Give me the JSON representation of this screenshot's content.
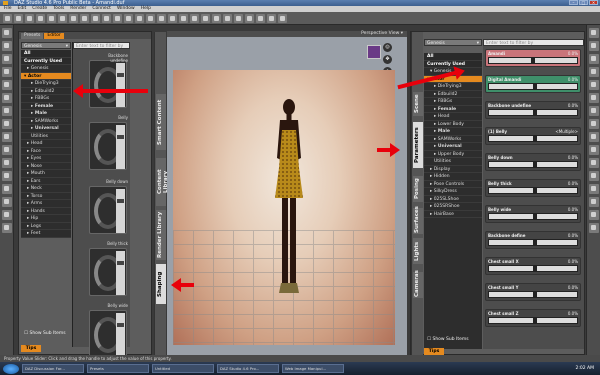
{
  "window": {
    "title": "DAZ Studio 4.6 Pro Public Beta - Amandi.duf"
  },
  "menu": [
    "File",
    "Edit",
    "Create",
    "Tools",
    "Render",
    "Connect",
    "Window",
    "Help"
  ],
  "left_panel": {
    "tabs": [
      {
        "label": "Presets"
      },
      {
        "label": "Editor"
      }
    ],
    "filter_dropdown": "Genesis",
    "search_placeholder": "Enter text to filter by",
    "tree": [
      {
        "label": "All",
        "style": "hdr"
      },
      {
        "label": "Currently Used",
        "style": "hdr"
      },
      {
        "label": "▸ Genesis",
        "style": "l1"
      },
      {
        "label": "▾ Actor",
        "style": "sel"
      },
      {
        "label": "▸ DieTrying3",
        "style": "l2"
      },
      {
        "label": "▸ Edbuild2",
        "style": "l2"
      },
      {
        "label": "▸ FBBGs",
        "style": "l2"
      },
      {
        "label": "▸ Female",
        "style": "l2 b"
      },
      {
        "label": "▸ Male",
        "style": "l2 b"
      },
      {
        "label": "▸ SAMWorks",
        "style": "l2"
      },
      {
        "label": "▸ Universal",
        "style": "l2 b"
      },
      {
        "label": "Utilities",
        "style": "l2"
      },
      {
        "label": "▸ Head",
        "style": "l1"
      },
      {
        "label": "▸ Face",
        "style": "l1"
      },
      {
        "label": "▸ Eyes",
        "style": "l1"
      },
      {
        "label": "▸ Nose",
        "style": "l1"
      },
      {
        "label": "▸ Mouth",
        "style": "l1"
      },
      {
        "label": "▸ Ears",
        "style": "l1"
      },
      {
        "label": "▸ Neck",
        "style": "l1"
      },
      {
        "label": "▸ Torso",
        "style": "l1"
      },
      {
        "label": "▸ Arms",
        "style": "l1"
      },
      {
        "label": "▸ Hands",
        "style": "l1"
      },
      {
        "label": "▸ Hip",
        "style": "l1"
      },
      {
        "label": "▸ Legs",
        "style": "l1"
      },
      {
        "label": "▸ Feet",
        "style": "l1"
      }
    ],
    "show_sub_items": "Show Sub Items",
    "tips": "Tips",
    "cards": [
      {
        "label": "Backbone undefine"
      },
      {
        "label": "Belly"
      },
      {
        "label": "Belly down"
      },
      {
        "label": "Belly thick"
      },
      {
        "label": "Belly wide"
      }
    ],
    "vtabs": [
      "Smart Content",
      "Content Library",
      "Render Library",
      "Shaping"
    ]
  },
  "viewport": {
    "camera_label": "Perspective View"
  },
  "right_panel": {
    "filter_dropdown": "Genesis",
    "search_placeholder": "Enter text to filter by",
    "tree": [
      {
        "label": "All",
        "style": "hdr"
      },
      {
        "label": "Currently Used",
        "style": "hdr"
      },
      {
        "label": "▾ Genesis",
        "style": "l1"
      },
      {
        "label": "▾ Actor",
        "style": "sel"
      },
      {
        "label": "▸ DieTrying3",
        "style": "l2"
      },
      {
        "label": "▸ Edbuild2",
        "style": "l2"
      },
      {
        "label": "▸ FBBGs",
        "style": "l2"
      },
      {
        "label": "▸ Female",
        "style": "l2 b"
      },
      {
        "label": "▸ Head",
        "style": "l2"
      },
      {
        "label": "▸ Lower Body",
        "style": "l2"
      },
      {
        "label": "▸ Male",
        "style": "l2 b"
      },
      {
        "label": "▸ SAMWorks",
        "style": "l2"
      },
      {
        "label": "▸ Universal",
        "style": "l2 b"
      },
      {
        "label": "▸ Upper Body",
        "style": "l2"
      },
      {
        "label": "Utilities",
        "style": "l2"
      },
      {
        "label": "▸ Display",
        "style": "l1"
      },
      {
        "label": "▸ Hidden",
        "style": "l1"
      },
      {
        "label": "▸ Pose Controls",
        "style": "l1"
      },
      {
        "label": "▸ SilkyDress",
        "style": "l1"
      },
      {
        "label": "▸ 025SLShoe",
        "style": "l1"
      },
      {
        "label": "▸ 025SRShoe",
        "style": "l1"
      },
      {
        "label": "▸ HairBase",
        "style": "l1"
      }
    ],
    "show_sub_items": "Show Sub Items",
    "tips": "Tips",
    "vtabs": [
      "Scene",
      "Parameters",
      "Posing",
      "Surfaces",
      "Lights",
      "Cameras"
    ],
    "sliders": [
      {
        "name": "Amandi",
        "value": "0.0%",
        "pos": 0.48,
        "color": "#c9747a"
      },
      {
        "name": "Digital Amandi",
        "value": "0.0%",
        "pos": 0.5,
        "color": "#3f8f6a"
      },
      {
        "name": "Backbone undefine",
        "value": "0.0%",
        "pos": 0.5,
        "color": "#444"
      },
      {
        "name": "(1) Belly",
        "value": "<Multiple>",
        "pos": 0.5,
        "color": "#444"
      },
      {
        "name": "Belly down",
        "value": "0.0%",
        "pos": 0.5,
        "color": "#444"
      },
      {
        "name": "Belly thick",
        "value": "0.0%",
        "pos": 0.5,
        "color": "#444"
      },
      {
        "name": "Belly wide",
        "value": "0.0%",
        "pos": 0.5,
        "color": "#444"
      },
      {
        "name": "Backbone define",
        "value": "0.0%",
        "pos": 0.5,
        "color": "#444"
      },
      {
        "name": "Chest small X",
        "value": "0.0%",
        "pos": 0.5,
        "color": "#444"
      },
      {
        "name": "Chest small Y",
        "value": "0.0%",
        "pos": 0.5,
        "color": "#444"
      },
      {
        "name": "Chest small Z",
        "value": "0.0%",
        "pos": 0.5,
        "color": "#444"
      }
    ]
  },
  "statusbar": "Property Value Slider: Click and drag the handle to adjust the value of this property.",
  "taskbar": {
    "items": [
      "DAZ Discussion For...",
      "Presets",
      "Untitled",
      "DAZ Studio 4.6 Pro...",
      "Web Image Manipul..."
    ],
    "clock": "2:02 AM"
  }
}
